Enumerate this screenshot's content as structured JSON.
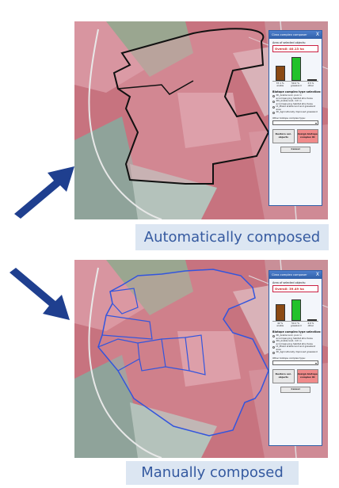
{
  "panels": [
    {
      "dialog": {
        "title": "Class complex composer",
        "close": "X",
        "area_label": "Area of selected objects:",
        "area_value": "Overall: 40.13 ha",
        "bars": [
          {
            "pct": "37.1 %",
            "name": "arable",
            "value": 37.1,
            "color": "#8b4a14"
          },
          {
            "pct": "59.2 %",
            "name": "grassland",
            "value": 59.2,
            "color": "#22c22a"
          },
          {
            "pct": "3.5 %",
            "name": "other",
            "value": 3.5,
            "color": "#d83a2a"
          }
        ],
        "type_title": "Biotope complex type selection:",
        "options": [
          "XII_Arable land, poor in accompanying habitat structures",
          "XIII_Arable land, rich in accompanying habitat structures",
          "IX_Mixed arable land and grassland area",
          "XII_Agriculturally improved grassland"
        ],
        "other_label": "Other biotope complex type:",
        "select_arrow": "▾",
        "restore_label": "Restore sel. objects",
        "assign_label": "Assign biotope complex ID",
        "cancel_label": "Cancel"
      },
      "caption": "Automatically composed",
      "outline_color": "#111111",
      "arrow_color": "#1f3f8f"
    },
    {
      "dialog": {
        "title": "Class complex composer",
        "close": "X",
        "area_label": "Area of selected objects:",
        "area_value": "Overall: 39.49 ha",
        "bars": [
          {
            "pct": "42 %",
            "name": "arable",
            "value": 42,
            "color": "#8b4a14"
          },
          {
            "pct": "54.1 %",
            "name": "grassland",
            "value": 54.1,
            "color": "#22c22a"
          },
          {
            "pct": "4.0 %",
            "name": "other",
            "value": 4.0,
            "color": "#d83a2a"
          }
        ],
        "type_title": "Biotope complex type selection:",
        "options": [
          "XII_Arable land, poor in accompanying habitat structures",
          "XIII_Arable land, rich in accompanying habitat structures",
          "IX_Mixed arable land and grassland area",
          "XII_Agriculturally improved grassland"
        ],
        "other_label": "Other biotope complex type:",
        "select_arrow": "▾",
        "restore_label": "Restore sel. objects",
        "assign_label": "Assign biotope complex ID",
        "cancel_label": "Cancel"
      },
      "caption": "Manually composed",
      "outline_color": "#3355dd",
      "arrow_color": "#1f3f8f"
    }
  ]
}
